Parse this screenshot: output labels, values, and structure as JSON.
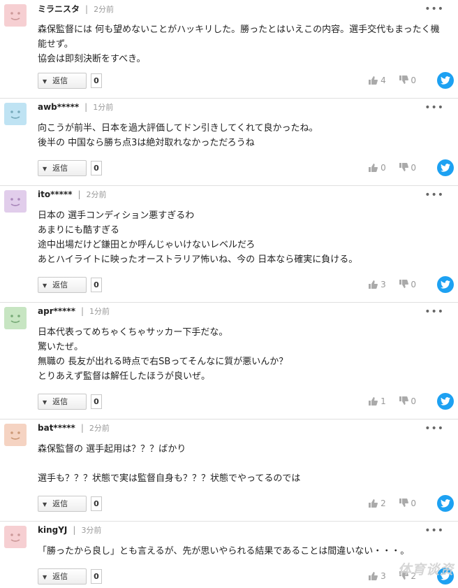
{
  "ui": {
    "reply_label": "返信",
    "more_label": "•••",
    "separator": "|"
  },
  "colors": {
    "twitter": "#1da1f2",
    "divider": "#e0e0e0"
  },
  "comments": [
    {
      "author": "ミラニスタ",
      "time": "2分前",
      "avatar_color": "#f6cfd2",
      "text": "森保監督には 何も望めないことがハッキリした。勝ったとはいえこの内容。選手交代もまったく機\n能せず。\n協会は即刻決断をすべき。",
      "replies": "0",
      "likes": "4",
      "dislikes": "0"
    },
    {
      "author": "awb*****",
      "time": "1分前",
      "avatar_color": "#bfe3f3",
      "text": "向こうが前半、日本を過大評価してドン引きしてくれて良かったね。\n後半の 中国なら勝ち点3は絶対取れなかっただろうね",
      "replies": "0",
      "likes": "0",
      "dislikes": "0"
    },
    {
      "author": "ito*****",
      "time": "2分前",
      "avatar_color": "#e1cdeb",
      "text": "日本の 選手コンディション悪すぎるわ\nあまりにも酷すぎる\n途中出場だけど鎌田とか呼んじゃいけないレベルだろ\nあとハイライトに映ったオーストラリア怖いね、今の 日本なら確実に負ける。",
      "replies": "0",
      "likes": "3",
      "dislikes": "0"
    },
    {
      "author": "apr*****",
      "time": "1分前",
      "avatar_color": "#c7e5c2",
      "text": "日本代表ってめちゃくちゃサッカー下手だな。\n驚いたぜ。\n無職の 長友が出れる時点で右SBってそんなに質が悪いんか？\nとりあえず監督は解任したほうが良いぜ。",
      "replies": "0",
      "likes": "1",
      "dislikes": "0"
    },
    {
      "author": "bat*****",
      "time": "2分前",
      "avatar_color": "#f5d3c2",
      "text": "森保監督の 選手起用は？？？ばかり\n\n選手も？？？状態で実は監督自身も？？？状態でやってるのでは",
      "replies": "0",
      "likes": "2",
      "dislikes": "0"
    },
    {
      "author": "kingYJ",
      "time": "3分前",
      "avatar_color": "#f6cfd2",
      "text": "「勝ったから良し」とも言えるが、先が思いやられる結果であることは間違いない・・・。",
      "replies": "0",
      "likes": "3",
      "dislikes": "2"
    }
  ],
  "watermark": "体育谈资"
}
